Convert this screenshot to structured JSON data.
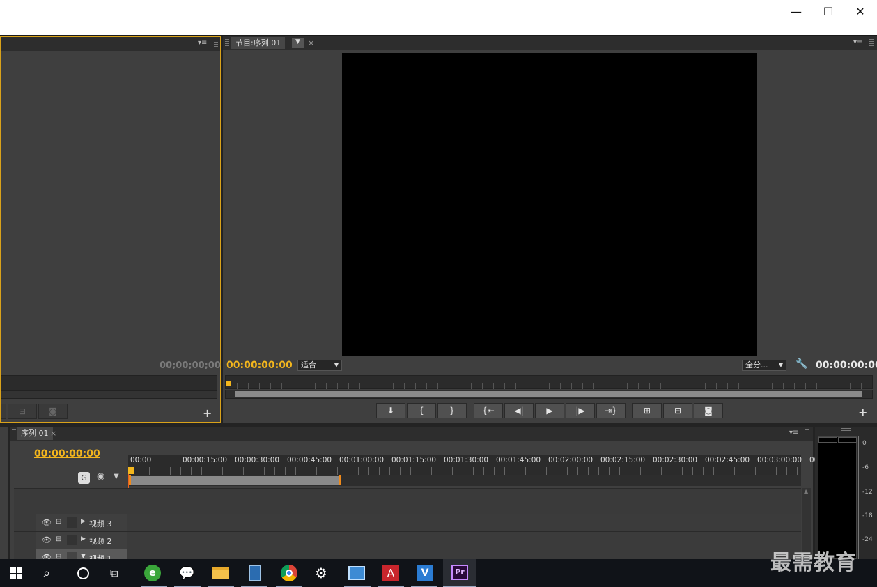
{
  "window": {
    "minimize_glyph": "—",
    "maximize_glyph": "☐",
    "close_glyph": "✕"
  },
  "source_monitor": {
    "timecode": "00;00;00;00",
    "plus_label": "+"
  },
  "program_monitor": {
    "tab_label": "节目:序列 01",
    "tab_close": "×",
    "timecode_left": "00:00:00:00",
    "fit_dropdown": "适合",
    "quality_dropdown": "全分...",
    "timecode_right": "00:00:00:00",
    "plus_label": "+",
    "buttons": [
      "marker",
      "mark-in",
      "mark-out",
      "go-to-in",
      "step-back",
      "play",
      "step-forward",
      "go-to-out",
      "lift",
      "extract",
      "export-frame"
    ]
  },
  "timeline": {
    "tab_label": "序列 01",
    "tab_close": "×",
    "timecode": "00:00:00:00",
    "ruler": [
      "00:00",
      "00:00:15:00",
      "00:00:30:00",
      "00:00:45:00",
      "00:01:00:00",
      "00:01:15:00",
      "00:01:30:00",
      "00:01:45:00",
      "00:02:00:00",
      "00:02:15:00",
      "00:02:30:00",
      "00:02:45:00",
      "00:03:00:00",
      "00:0"
    ],
    "tracks": [
      {
        "name": "视频 3"
      },
      {
        "name": "视频 2"
      },
      {
        "name": "视频 1"
      }
    ]
  },
  "audio_meter": {
    "labels": [
      "0",
      "-6",
      "-12",
      "-18",
      "-24"
    ]
  },
  "taskbar": {
    "icons": [
      "windows-start-icon",
      "search-icon",
      "cortana-icon",
      "task-view-icon",
      "ie-browser-icon",
      "wechat-icon",
      "file-explorer-icon",
      "calculator-icon",
      "chrome-icon",
      "settings-icon",
      "control-panel-icon",
      "autocad-icon",
      "visio-icon",
      "premiere-pro-icon"
    ],
    "premiere_label": "Pr"
  },
  "watermark": "最需教育",
  "colors": {
    "accent_timecode": "#f3b61d",
    "panel_bg": "#3f3f3f",
    "active_border": "#d9a21a",
    "playhead": "#e8621f"
  }
}
